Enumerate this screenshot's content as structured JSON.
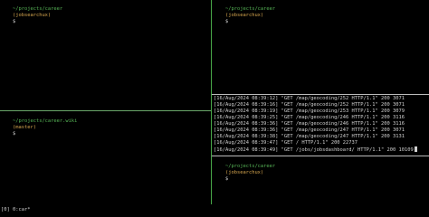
{
  "panes": {
    "top_left": {
      "prompt": {
        "path": "~/projects/career",
        "branch": "(jobsearchux)",
        "symbol": "$"
      }
    },
    "bottom_left": {
      "prompt": {
        "path": "~/projects/career.wiki",
        "branch": "(master)",
        "symbol": "$"
      }
    },
    "top_right": {
      "prompt": {
        "path": "~/projects/career",
        "branch": "(jobsearchux)",
        "symbol": "$"
      }
    },
    "middle_right": {
      "log_lines": [
        "[16/Aug/2024 08:39:12] \"GET /map/geocoding/252 HTTP/1.1\" 200 3071",
        "[16/Aug/2024 08:39:16] \"GET /map/geocoding/252 HTTP/1.1\" 200 3071",
        "[16/Aug/2024 08:39:19] \"GET /map/geocoding/253 HTTP/1.1\" 200 3079",
        "[16/Aug/2024 08:39:25] \"GET /map/geocoding/246 HTTP/1.1\" 200 3116",
        "[16/Aug/2024 08:39:36] \"GET /map/geocoding/246 HTTP/1.1\" 200 3116",
        "[16/Aug/2024 08:39:36] \"GET /map/geocoding/247 HTTP/1.1\" 200 3071",
        "[16/Aug/2024 08:39:38] \"GET /map/geocoding/247 HTTP/1.1\" 200 3131",
        "[16/Aug/2024 08:39:47] \"GET / HTTP/1.1\" 200 22737",
        "[16/Aug/2024 08:39:49] \"GET /jobs/jobsdashboard/ HTTP/1.1\" 200 10109"
      ]
    },
    "bottom_right": {
      "prompt": {
        "path": "~/projects/career",
        "branch": "(jobsearchux)",
        "symbol": "$"
      }
    }
  },
  "status_bar": {
    "text": "[0] 0:car*"
  },
  "colors": {
    "background": "#000000",
    "path": "#56b456",
    "branch": "#d7a74f",
    "text": "#d0d0d0"
  }
}
